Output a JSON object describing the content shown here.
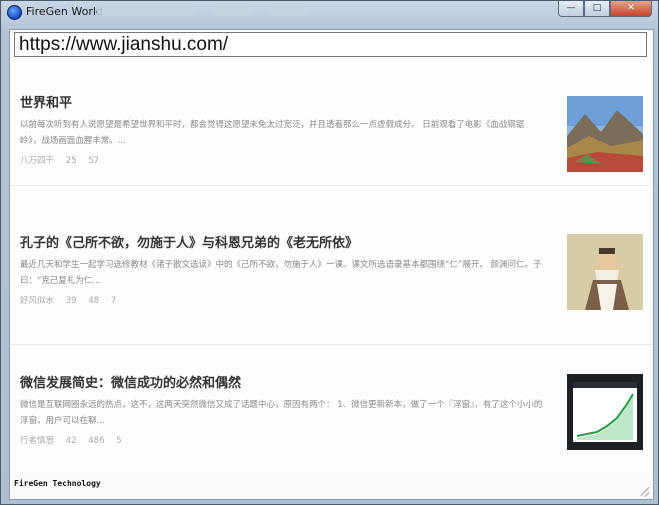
{
  "window": {
    "title": "FireGen World",
    "controls": {
      "minimize": "—",
      "maximize": "□",
      "close": "✕"
    }
  },
  "address_bar": {
    "value": "https://www.jianshu.com/"
  },
  "articles": [
    {
      "title": "世界和平",
      "abstract": "以前每次听到有人说愿望是希望世界和平时，都会觉得这愿望未免太过宽泛，并且透着那么一点虚假成分。  日前观看了电影《血战钢锯岭》，战场画面血腥丰常。...",
      "author": "八万四千",
      "views": "25",
      "comments": "57",
      "likes": "",
      "thumbnail": "landscape-photo"
    },
    {
      "title": "孔子的《己所不欲，勿施于人》与科恩兄弟的《老无所依》",
      "abstract": "最近几天和学生一起学习选修教材《诸子散文选读》中的《己所不欲，勿施于人》一课。课文所选语录基本都围绕“仁”展开。 颜渊问仁。子曰：“克己复礼为仁...",
      "author": "好风似水",
      "views": "39",
      "comments": "48",
      "likes": "7",
      "thumbnail": "confucius-painting"
    },
    {
      "title": "微信发展简史：微信成功的必然和偶然",
      "abstract": "微信是互联网圈永远的热点，这不，这两天突然微信又成了话题中心，原因有两个： 1、微信更新新本，做了一个『浮窗』，有了这个小小的浮窗，用户可以在聊...",
      "author": "行者慎思",
      "views": "42",
      "comments": "486",
      "likes": "5",
      "thumbnail": "growth-chart-screenshot"
    }
  ],
  "status_bar": {
    "text": "FireGen Technology"
  },
  "colors": {
    "window_frame": "#b4c4d8",
    "close_button": "#c8442c",
    "title_text": "#333333",
    "abstract_text": "#888888",
    "meta_text": "#aaaaaa"
  }
}
